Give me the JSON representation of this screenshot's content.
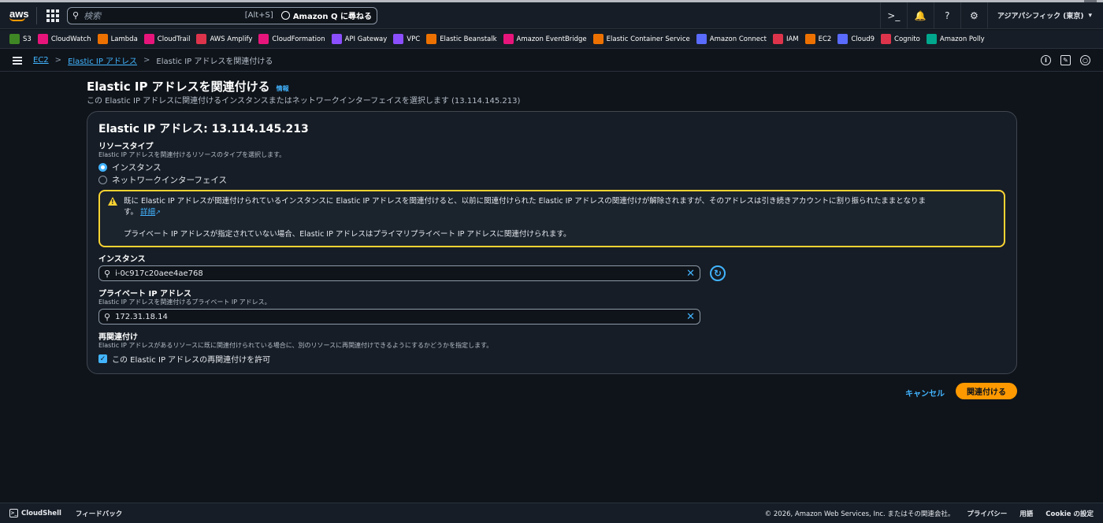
{
  "topnav": {
    "search_placeholder": "検索",
    "search_shortcut": "[Alt+S]",
    "amazon_q_label": "Amazon Q に尋ねる",
    "region": "アジアパシフィック (東京)"
  },
  "favorites": [
    {
      "label": "S3",
      "color": "#3f8624"
    },
    {
      "label": "CloudWatch",
      "color": "#e7157b"
    },
    {
      "label": "Lambda",
      "color": "#ed7100"
    },
    {
      "label": "CloudTrail",
      "color": "#e7157b"
    },
    {
      "label": "AWS Amplify",
      "color": "#dd344c"
    },
    {
      "label": "CloudFormation",
      "color": "#e7157b"
    },
    {
      "label": "API Gateway",
      "color": "#8c4fff"
    },
    {
      "label": "VPC",
      "color": "#8c4fff"
    },
    {
      "label": "Elastic Beanstalk",
      "color": "#ed7100"
    },
    {
      "label": "Amazon EventBridge",
      "color": "#e7157b"
    },
    {
      "label": "Elastic Container Service",
      "color": "#ed7100"
    },
    {
      "label": "Amazon Connect",
      "color": "#5a6bff"
    },
    {
      "label": "IAM",
      "color": "#dd344c"
    },
    {
      "label": "EC2",
      "color": "#ed7100"
    },
    {
      "label": "Cloud9",
      "color": "#5a6bff"
    },
    {
      "label": "Cognito",
      "color": "#dd344c"
    },
    {
      "label": "Amazon Polly",
      "color": "#01a88d"
    }
  ],
  "breadcrumb": {
    "ec2": "EC2",
    "eip": "Elastic IP アドレス",
    "current": "Elastic IP アドレスを関連付ける"
  },
  "page": {
    "title": "Elastic IP アドレスを関連付ける",
    "info": "情報",
    "description": "この Elastic IP アドレスに関連付けるインスタンスまたはネットワークインターフェイスを選択します (13.114.145.213)"
  },
  "panel": {
    "title": "Elastic IP アドレス: 13.114.145.213",
    "resource_type_label": "リソースタイプ",
    "resource_type_desc": "Elastic IP アドレスを関連付けるリソースのタイプを選択します。",
    "radio_instance": "インスタンス",
    "radio_eni": "ネットワークインターフェイス",
    "alert_text1": "既に Elastic IP アドレスが関連付けられているインスタンスに Elastic IP アドレスを関連付けると、以前に関連付けられた Elastic IP アドレスの関連付けが解除されますが、そのアドレスは引き続きアカウントに割り振られたままとなりま",
    "alert_text1b": "す。",
    "alert_link": "詳細",
    "alert_text2": "プライベート IP アドレスが指定されていない場合、Elastic IP アドレスはプライマリプライベート IP アドレスに関連付けられます。",
    "instance_label": "インスタンス",
    "instance_value": "i-0c917c20aee4ae768",
    "private_ip_label": "プライベート IP アドレス",
    "private_ip_desc": "Elastic IP アドレスを関連付けるプライベート IP アドレス。",
    "private_ip_value": "172.31.18.14",
    "reassoc_label": "再関連付け",
    "reassoc_desc": "Elastic IP アドレスがあるリソースに既に関連付けられている場合に、別のリソースに再関連付けできるようにするかどうかを指定します。",
    "reassoc_checkbox": "この Elastic IP アドレスの再関連付けを許可"
  },
  "actions": {
    "cancel": "キャンセル",
    "associate": "関連付ける"
  },
  "footer": {
    "cloudshell": "CloudShell",
    "feedback": "フィードバック",
    "copyright": "© 2026, Amazon Web Services, Inc. またはその関連会社。",
    "privacy": "プライバシー",
    "terms": "用語",
    "cookie": "Cookie の設定"
  }
}
